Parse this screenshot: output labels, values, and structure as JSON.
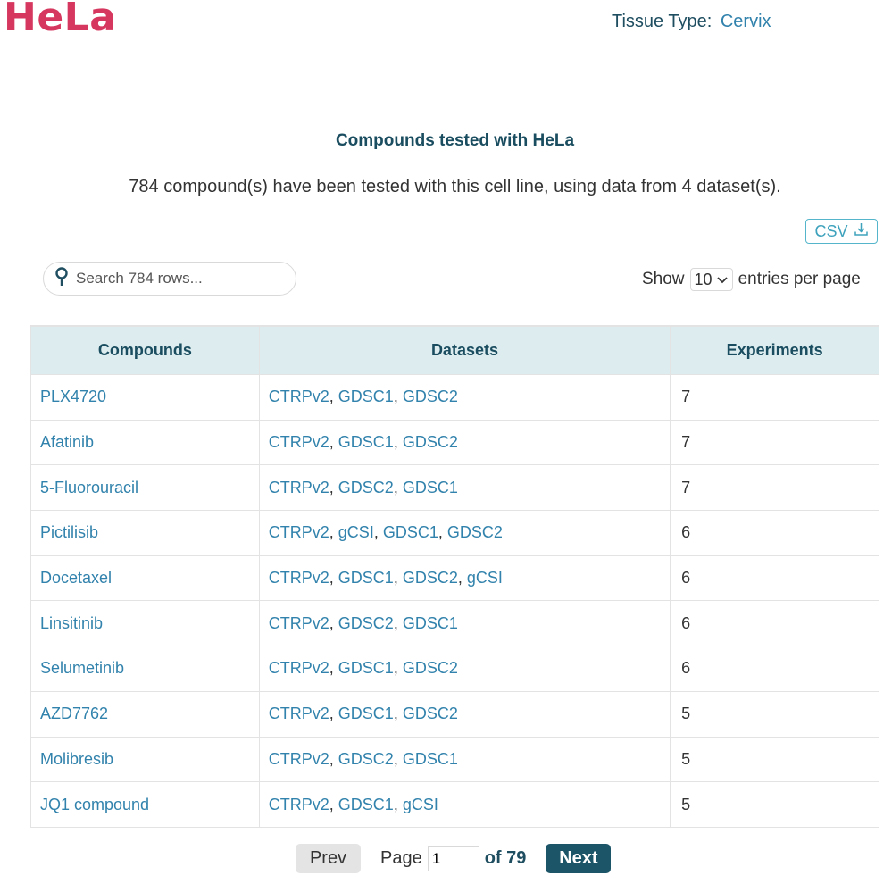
{
  "header": {
    "title": "HeLa",
    "tissue_label": "Tissue Type:",
    "tissue_value": "Cervix"
  },
  "section": {
    "heading": "Compounds tested with HeLa",
    "summary": "784 compound(s) have been tested with this cell line, using data from 4 dataset(s)."
  },
  "toolbar": {
    "csv_label": "CSV",
    "search_placeholder": "Search 784 rows...",
    "show_label": "Show",
    "entries_value": "10",
    "entries_suffix": "entries per page"
  },
  "table": {
    "columns": [
      "Compounds",
      "Datasets",
      "Experiments"
    ],
    "rows": [
      {
        "compound": "PLX4720",
        "datasets": [
          "CTRPv2",
          "GDSC1",
          "GDSC2"
        ],
        "experiments": "7"
      },
      {
        "compound": "Afatinib",
        "datasets": [
          "CTRPv2",
          "GDSC1",
          "GDSC2"
        ],
        "experiments": "7"
      },
      {
        "compound": "5-Fluorouracil",
        "datasets": [
          "CTRPv2",
          "GDSC2",
          "GDSC1"
        ],
        "experiments": "7"
      },
      {
        "compound": "Pictilisib",
        "datasets": [
          "CTRPv2",
          "gCSI",
          "GDSC1",
          "GDSC2"
        ],
        "experiments": "6"
      },
      {
        "compound": "Docetaxel",
        "datasets": [
          "CTRPv2",
          "GDSC1",
          "GDSC2",
          "gCSI"
        ],
        "experiments": "6"
      },
      {
        "compound": "Linsitinib",
        "datasets": [
          "CTRPv2",
          "GDSC2",
          "GDSC1"
        ],
        "experiments": "6"
      },
      {
        "compound": "Selumetinib",
        "datasets": [
          "CTRPv2",
          "GDSC1",
          "GDSC2"
        ],
        "experiments": "6"
      },
      {
        "compound": "AZD7762",
        "datasets": [
          "CTRPv2",
          "GDSC1",
          "GDSC2"
        ],
        "experiments": "5"
      },
      {
        "compound": "Molibresib",
        "datasets": [
          "CTRPv2",
          "GDSC2",
          "GDSC1"
        ],
        "experiments": "5"
      },
      {
        "compound": "JQ1 compound",
        "datasets": [
          "CTRPv2",
          "GDSC1",
          "gCSI"
        ],
        "experiments": "5"
      }
    ]
  },
  "pagination": {
    "prev_label": "Prev",
    "page_label": "Page",
    "current_page": "1",
    "of_label": "of 79",
    "next_label": "Next"
  },
  "colors": {
    "title": "#d6375f",
    "link": "#3182ac",
    "header_bg": "#dcecef",
    "next_bg": "#1d5568"
  },
  "icons": {
    "search": "search-icon",
    "download": "download-icon",
    "chevron": "chevron-down-icon"
  }
}
